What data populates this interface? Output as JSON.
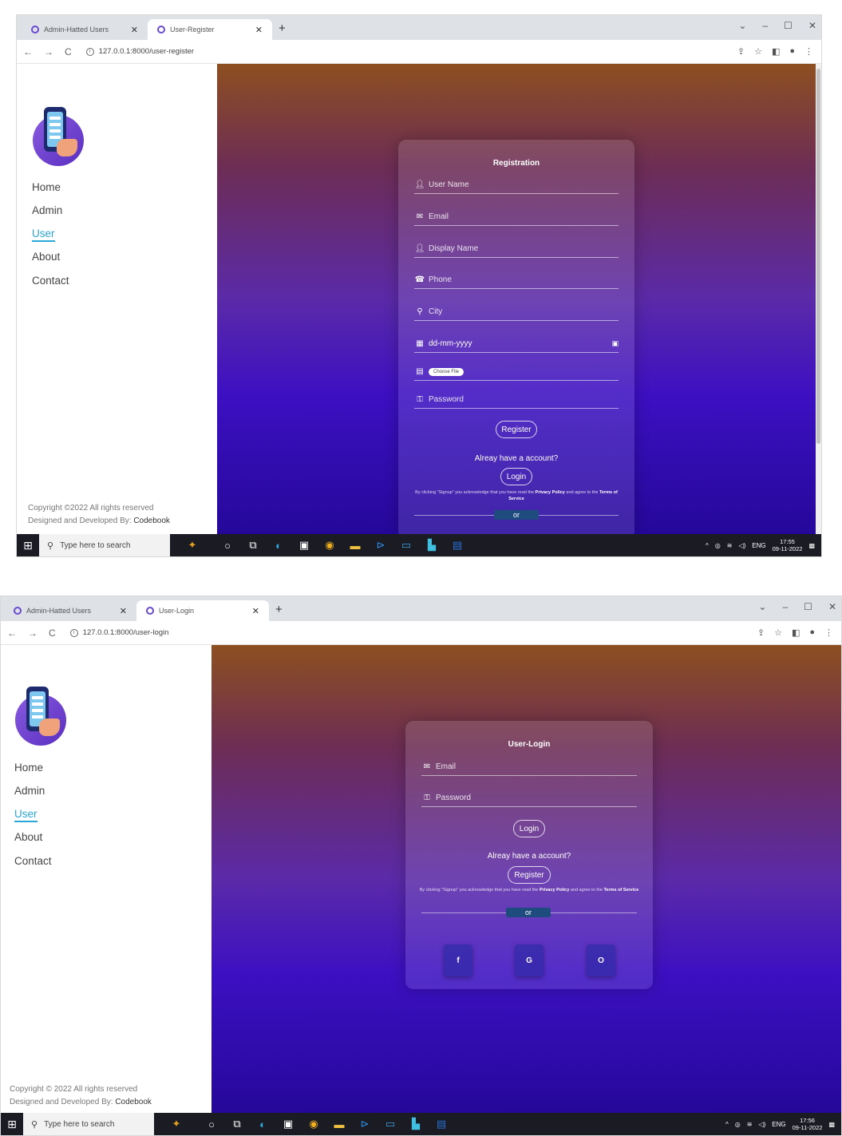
{
  "shot1": {
    "tabs": [
      {
        "label": "Admin-Hatted Users"
      },
      {
        "label": "User-Register"
      }
    ],
    "url": "127.0.0.1:8000/user-register",
    "nav": [
      "Home",
      "Admin",
      "User",
      "About",
      "Contact"
    ],
    "footer": {
      "line1": "Copyright ©2022 All rights reserved",
      "line2_prefix": "Designed and Developed By:",
      "line2_brand": "Codebook"
    },
    "form": {
      "title": "Registration",
      "fields": [
        {
          "icon": "user-icon",
          "placeholder": "User Name"
        },
        {
          "icon": "mail-icon",
          "placeholder": "Email"
        },
        {
          "icon": "user-icon",
          "placeholder": "Display Name"
        },
        {
          "icon": "phone-icon",
          "placeholder": "Phone"
        },
        {
          "icon": "location-icon",
          "placeholder": "City"
        },
        {
          "icon": "calendar-icon",
          "placeholder": "dd-mm-yyyy"
        },
        {
          "icon": "file-icon",
          "placeholder": "Choose File"
        },
        {
          "icon": "key-icon",
          "placeholder": "Password"
        }
      ],
      "submit_label": "Register",
      "already_text": "Alreay have a account?",
      "alt_label": "Login",
      "fine_print_prefix": "By clicking \"Signup\" you acknowledge that you have read the",
      "fine_privacy": "Privacy Policy",
      "fine_mid": "and agree to the",
      "fine_terms": "Terms of Service",
      "or_label": "or"
    },
    "taskbar": {
      "search_placeholder": "Type here to search",
      "lang": "ENG",
      "time": "17:55",
      "date": "09-11-2022"
    }
  },
  "shot2": {
    "tabs": [
      {
        "label": "Admin-Hatted Users"
      },
      {
        "label": "User-Login"
      }
    ],
    "url": "127.0.0.1:8000/user-login",
    "nav": [
      "Home",
      "Admin",
      "User",
      "About",
      "Contact"
    ],
    "footer": {
      "line1": "Copyright © 2022 All rights reserved",
      "line2_prefix": "Designed and Developed By:",
      "line2_brand": "Codebook"
    },
    "form": {
      "title": "User-Login",
      "fields": [
        {
          "icon": "mail-icon",
          "placeholder": "Email"
        },
        {
          "icon": "key-icon",
          "placeholder": "Password"
        }
      ],
      "submit_label": "Login",
      "already_text": "Alreay have a account?",
      "alt_label": "Register",
      "fine_print_prefix": "By clicking \"Signup\" you acknowledge that you have read the",
      "fine_privacy": "Privacy Policy",
      "fine_mid": "and agree to the",
      "fine_terms": "Terms of Service",
      "or_label": "or",
      "social": [
        "f",
        "G",
        "O"
      ]
    },
    "taskbar": {
      "search_placeholder": "Type here to search",
      "lang": "ENG",
      "time": "17:56",
      "date": "09-11-2022"
    }
  },
  "colors": {
    "accent": "#2aa7d6",
    "gradient_top": "#8d4f20",
    "gradient_bottom": "#25089a"
  }
}
